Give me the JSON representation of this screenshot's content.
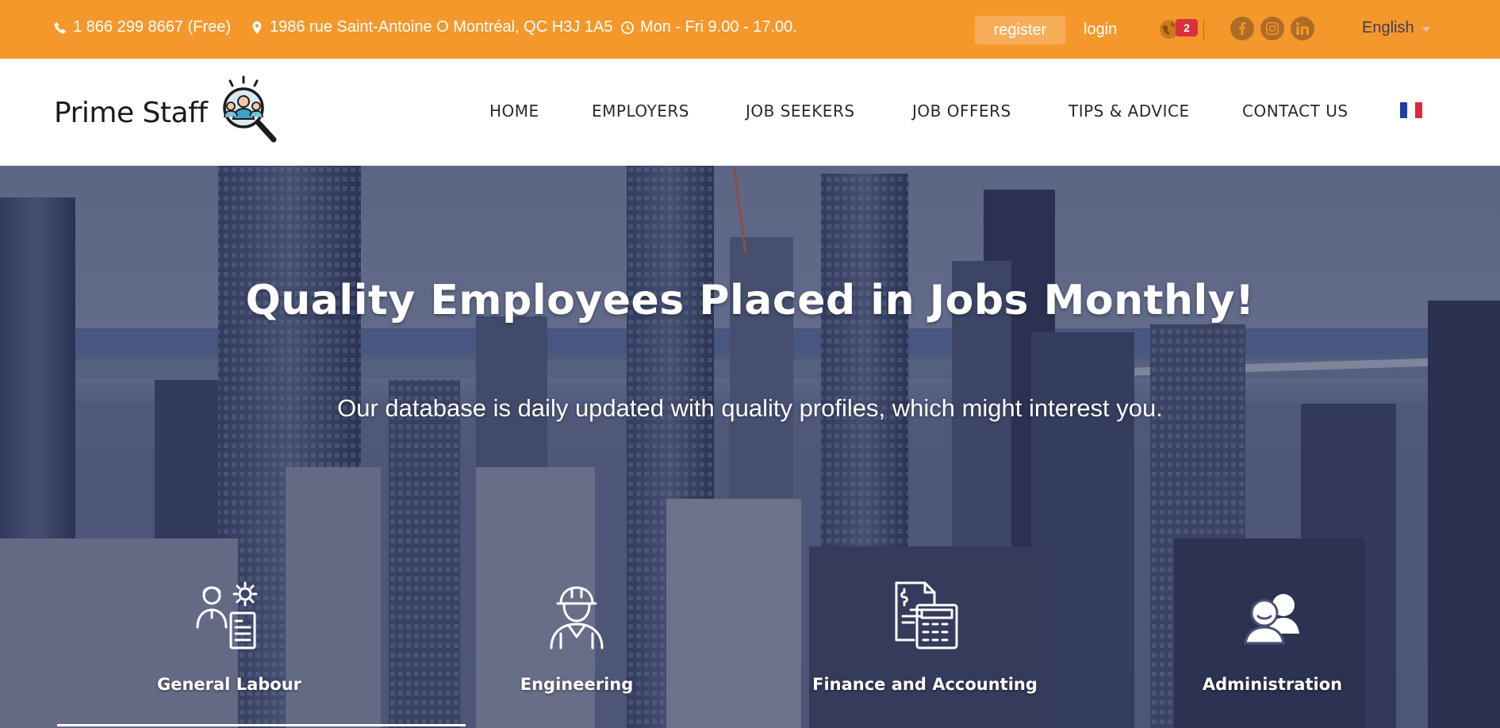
{
  "topbar": {
    "phone": "1 866 299 8667 (Free)",
    "address": "1986 rue Saint-Antoine O Montréal, QC H3J 1A5",
    "hours": "Mon - Fri 9.00 - 17.00.",
    "register_label": "register",
    "login_label": "login",
    "notification_count": "2",
    "language": "English",
    "socials": [
      "facebook-icon",
      "instagram-icon",
      "linkedin-icon"
    ],
    "accent_color": "#f5982b"
  },
  "brand": {
    "name": "Prime Staff"
  },
  "nav": {
    "items": [
      {
        "label": "HOME"
      },
      {
        "label": "EMPLOYERS"
      },
      {
        "label": "JOB SEEKERS"
      },
      {
        "label": "JOB OFFERS"
      },
      {
        "label": "TIPS & ADVICE"
      },
      {
        "label": "CONTACT US"
      }
    ],
    "flag_colors": [
      "#1f3ea6",
      "#ffffff",
      "#e0273a"
    ]
  },
  "hero": {
    "title": "Quality Employees Placed in Jobs Monthly!",
    "subtitle": "Our database is daily updated with quality profiles, which might interest you.",
    "categories": [
      {
        "label": "General Labour",
        "icon": "worker-gear-icon"
      },
      {
        "label": "Engineering",
        "icon": "engineer-helmet-icon"
      },
      {
        "label": "Finance and Accounting",
        "icon": "calculator-invoice-icon"
      },
      {
        "label": "Administration",
        "icon": "people-group-icon"
      }
    ]
  }
}
